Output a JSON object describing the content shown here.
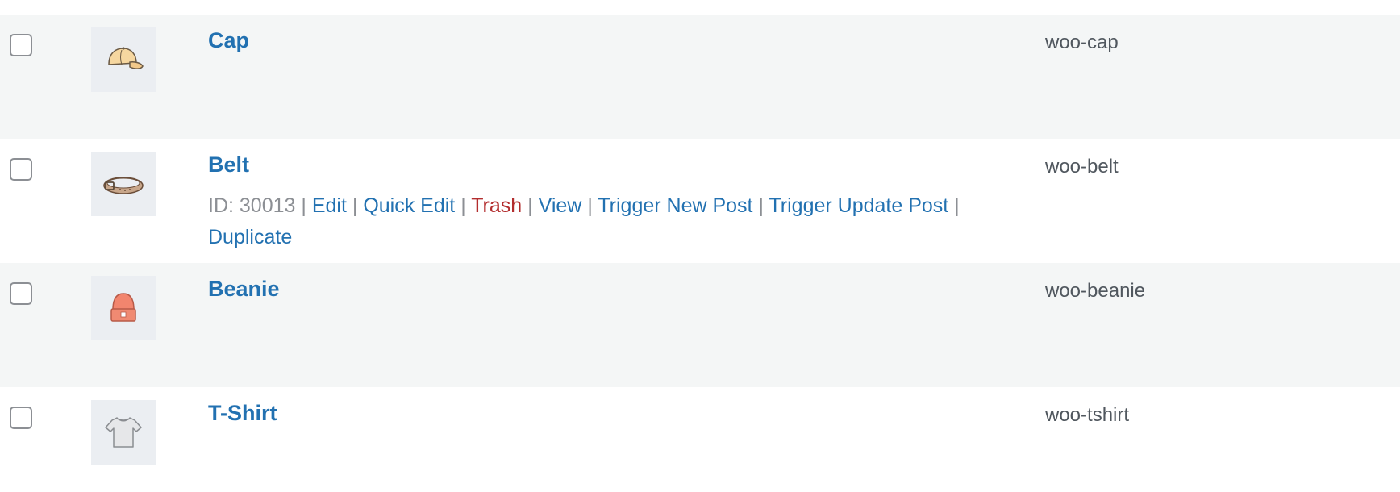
{
  "products": [
    {
      "name": "Cap",
      "slug": "woo-cap",
      "thumb_icon": "cap-icon"
    },
    {
      "name": "Belt",
      "slug": "woo-belt",
      "thumb_icon": "belt-icon",
      "actions": {
        "id": "ID: 30013",
        "edit": "Edit",
        "quick_edit": "Quick Edit",
        "trash": "Trash",
        "view": "View",
        "trigger_new_post": "Trigger New Post",
        "trigger_update_post": "Trigger Update Post",
        "duplicate": "Duplicate"
      }
    },
    {
      "name": "Beanie",
      "slug": "woo-beanie",
      "thumb_icon": "beanie-icon"
    },
    {
      "name": "T-Shirt",
      "slug": "woo-tshirt",
      "thumb_icon": "tshirt-icon"
    }
  ],
  "separator": "|",
  "colors": {
    "link": "#2271b1",
    "trash": "#b32d2e",
    "muted": "#8c8f94",
    "alt_row": "#f4f6f6"
  }
}
